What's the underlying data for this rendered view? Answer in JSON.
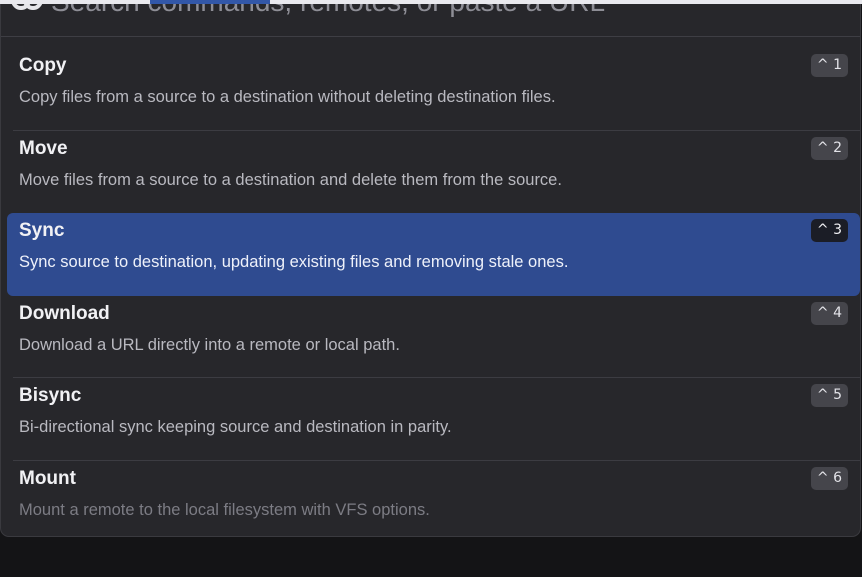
{
  "search": {
    "placeholder": "Search commands, remotes, or paste a URL",
    "icon": "logo-icon"
  },
  "commands": [
    {
      "title": "Copy",
      "description": "Copy files from a source to a destination without deleting destination files.",
      "shortcut": "^ 1"
    },
    {
      "title": "Move",
      "description": "Move files from a source to a destination and delete them from the source.",
      "shortcut": "^ 2"
    },
    {
      "title": "Sync",
      "description": "Sync source to destination, updating existing files and removing stale ones.",
      "shortcut": "^ 3",
      "selected": true
    },
    {
      "title": "Download",
      "description": "Download a URL directly into a remote or local path.",
      "shortcut": "^ 4"
    },
    {
      "title": "Bisync",
      "description": "Bi-directional sync keeping source and destination in parity.",
      "shortcut": "^ 5"
    },
    {
      "title": "Mount",
      "description": "Mount a remote to the local filesystem with VFS options.",
      "shortcut": "^ 6"
    }
  ],
  "colors": {
    "background": "#141416",
    "panel": "#27272b",
    "selected": "#2f4b90",
    "shortcut_badge": "#45454b"
  }
}
